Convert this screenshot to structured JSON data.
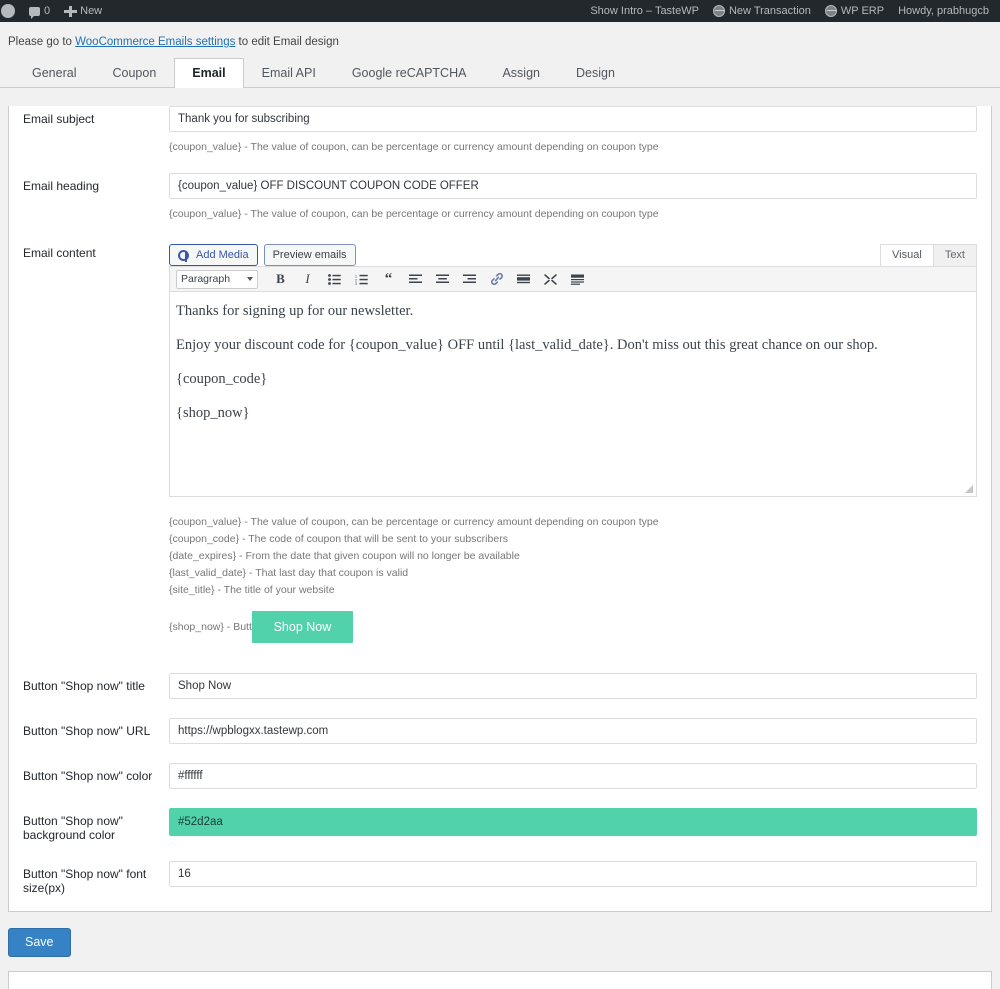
{
  "adminbar": {
    "left": [
      {
        "name": "wp-logo",
        "label": ""
      },
      {
        "name": "comments",
        "label": "0"
      },
      {
        "name": "new-content",
        "label": "New"
      }
    ],
    "right": [
      {
        "name": "show-intro",
        "label": "Show Intro – TasteWP"
      },
      {
        "name": "new-transaction",
        "label": "New Transaction"
      },
      {
        "name": "wp-erp",
        "label": "WP ERP"
      },
      {
        "name": "howdy",
        "label": "Howdy, prabhugcb"
      }
    ]
  },
  "notice": {
    "before": "Please go to ",
    "link": "WooCommerce Emails settings",
    "after": " to edit Email design"
  },
  "tabs": [
    {
      "label": "General",
      "active": false
    },
    {
      "label": "Coupon",
      "active": false
    },
    {
      "label": "Email",
      "active": true
    },
    {
      "label": "Email API",
      "active": false
    },
    {
      "label": "Google reCAPTCHA",
      "active": false
    },
    {
      "label": "Assign",
      "active": false
    },
    {
      "label": "Design",
      "active": false
    }
  ],
  "fields": {
    "email_subject": {
      "label": "Email subject",
      "value": "Thank you for subscribing",
      "hint": "{coupon_value} - The value of coupon, can be percentage or currency amount depending on coupon type"
    },
    "email_heading": {
      "label": "Email heading",
      "value": "{coupon_value} OFF DISCOUNT COUPON CODE OFFER",
      "hint": "{coupon_value} - The value of coupon, can be percentage or currency amount depending on coupon type"
    },
    "email_content": {
      "label": "Email content"
    },
    "button_title": {
      "label": "Button \"Shop now\" title",
      "value": "Shop Now"
    },
    "button_url": {
      "label": "Button \"Shop now\" URL",
      "value": "https://wpblogxx.tastewp.com"
    },
    "button_color": {
      "label": "Button \"Shop now\" color",
      "value": "#ffffff"
    },
    "button_bg_color": {
      "label": "Button \"Shop now\" background color",
      "value": "#52d2aa"
    },
    "button_font_size": {
      "label": "Button \"Shop now\" font size(px)",
      "value": "16"
    }
  },
  "editor": {
    "add_media_label": "Add Media",
    "preview_emails_label": "Preview emails",
    "visual_tab": "Visual",
    "text_tab": "Text",
    "format_select": "Paragraph",
    "toolbar_icons": [
      "bold-icon",
      "italic-icon",
      "bulleted-list-icon",
      "numbered-list-icon",
      "blockquote-icon",
      "align-left-icon",
      "align-center-icon",
      "align-right-icon",
      "link-icon",
      "read-more-icon",
      "fullscreen-icon",
      "toolbar-toggle-icon"
    ],
    "content_paragraphs": [
      "Thanks for signing up for our newsletter.",
      "Enjoy your discount code for {coupon_value} OFF until {last_valid_date}. Don't miss out this great chance on our shop.",
      "{coupon_code}",
      "{shop_now}"
    ]
  },
  "placeholders": [
    "{coupon_value} - The value of coupon, can be percentage or currency amount depending on coupon type",
    "{coupon_code} - The code of coupon that will be sent to your subscribers",
    "{date_expires} - From the date that given coupon will no longer be available",
    "{last_valid_date} - That last day that coupon is valid",
    "{site_title} - The title of your website"
  ],
  "shop_now_row": {
    "prefix": "{shop_now} - Button",
    "button_label": "Shop Now"
  },
  "save": {
    "label": "Save"
  },
  "colors": {
    "accent_green": "#52d2aa",
    "save_blue": "#3582c4",
    "link_blue": "#2271b1",
    "adminbar_bg": "#23282d"
  }
}
